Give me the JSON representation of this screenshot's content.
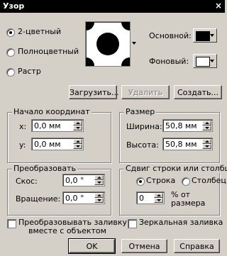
{
  "window": {
    "title": "Узор",
    "close_glyph": "×"
  },
  "pattern_type": {
    "options": [
      {
        "label": "2-цветный",
        "selected": true
      },
      {
        "label": "Полноцветный",
        "selected": false
      },
      {
        "label": "Растр",
        "selected": false
      }
    ]
  },
  "colors": {
    "foreground_label": "Основной:",
    "foreground_color": "#000000",
    "background_label": "Фоновый:",
    "background_color": "#ffffff"
  },
  "buttons": {
    "load": "Загрузить...",
    "delete": "Удалить",
    "create": "Создать...",
    "ok": "OK",
    "cancel": "Отмена",
    "help": "Справка"
  },
  "origin": {
    "legend": "Начало координат",
    "x_label": "x:",
    "x_value": "0,0 мм",
    "y_label": "y:",
    "y_value": "0,0 мм"
  },
  "size": {
    "legend": "Размер",
    "width_label": "Ширина:",
    "width_value": "50,8 мм",
    "height_label": "Высота:",
    "height_value": "50,8 мм"
  },
  "transform": {
    "legend": "Преобразовать",
    "skew_label": "Скос:",
    "skew_value": "0,0 °",
    "rotate_label": "Вращение:",
    "rotate_value": "0,0 °"
  },
  "offset": {
    "legend": "Сдвиг строки или столбца",
    "row_label": "Строка",
    "row_selected": true,
    "column_label": "Столбец",
    "column_selected": false,
    "value": "0",
    "unit_label_1": "% от",
    "unit_label_2": "размера"
  },
  "options": {
    "transform_fill_line1": "Преобразовывать заливку",
    "transform_fill_line2": "вместе с объектом",
    "transform_fill_checked": false,
    "mirror_fill": "Зеркальная заливка",
    "mirror_fill_checked": false
  }
}
